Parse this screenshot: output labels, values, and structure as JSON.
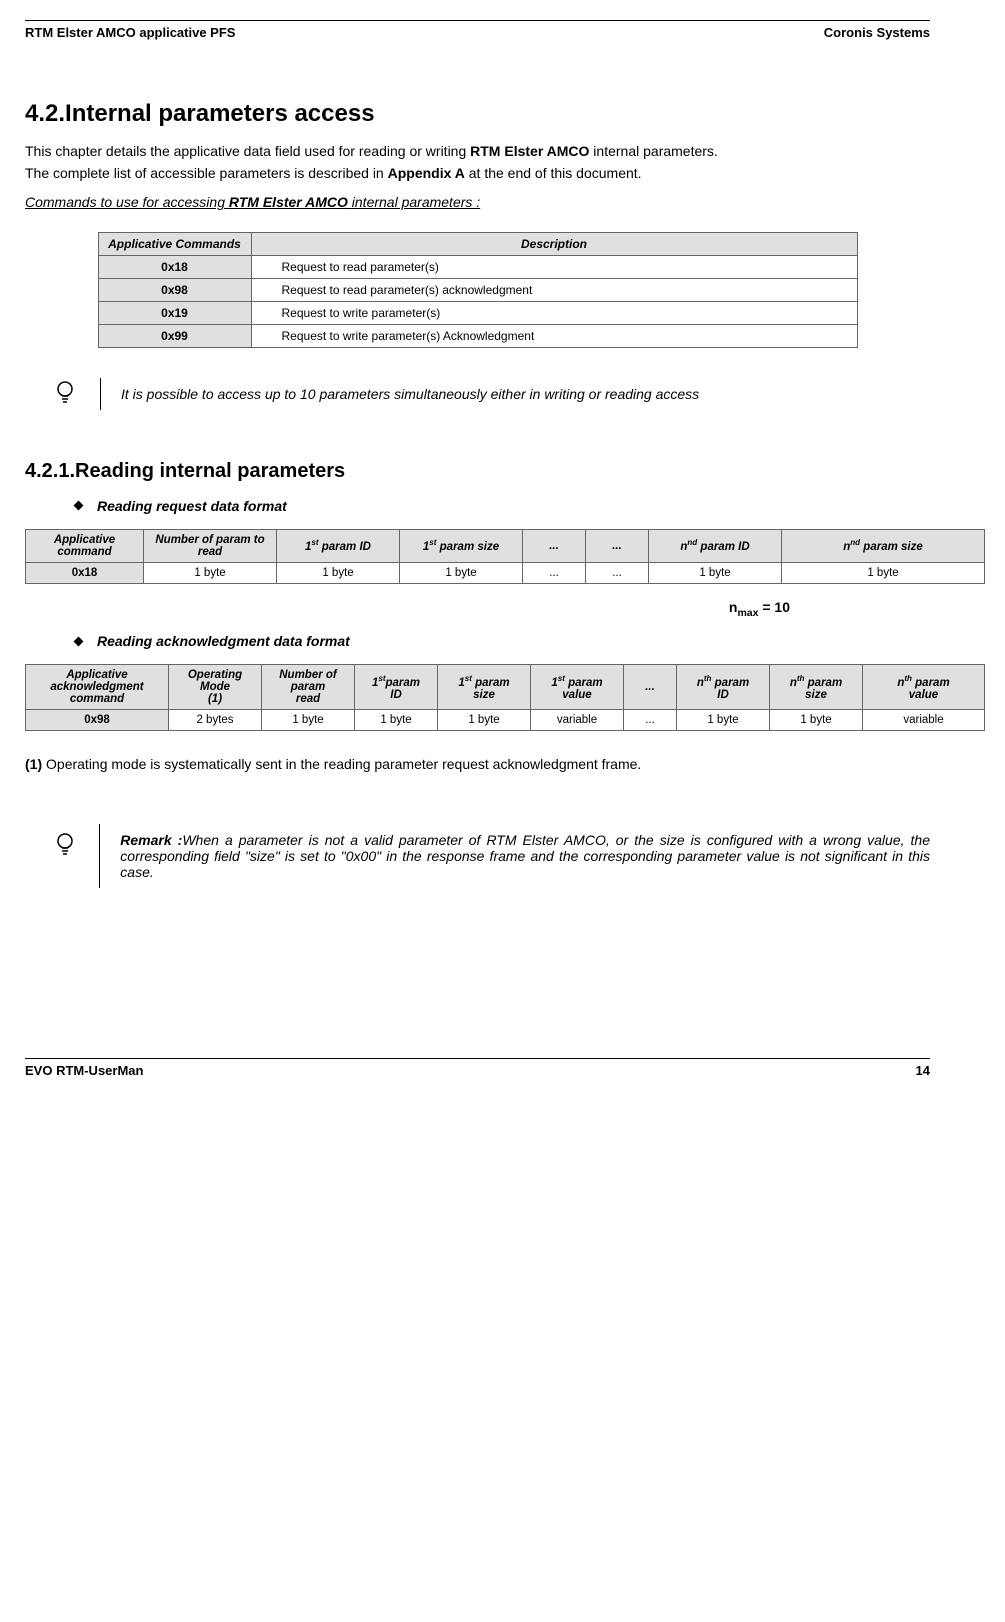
{
  "header": {
    "left": "RTM Elster AMCO applicative PFS",
    "right": "Coronis Systems"
  },
  "h1": "4.2.Internal parameters access",
  "intro1a": "This chapter details the applicative data field used for reading or writing ",
  "intro1b": "RTM Elster AMCO",
  "intro1c": " internal parameters.",
  "intro2a": "The complete list of accessible parameters is described in ",
  "intro2b": "Appendix A",
  "intro2c": " at the end of this document.",
  "cmds_title_a": "Commands to use for accessing ",
  "cmds_title_b": "RTM Elster AMCO",
  "cmds_title_c": " internal parameters :",
  "t1": {
    "h1": "Applicative Commands",
    "h2": "Description",
    "rows": [
      {
        "c": "0x18",
        "d": "Request to read parameter(s)"
      },
      {
        "c": "0x98",
        "d": "Request to read parameter(s) acknowledgment"
      },
      {
        "c": "0x19",
        "d": "Request to write parameter(s)"
      },
      {
        "c": "0x99",
        "d": "Request to write parameter(s) Acknowledgment"
      }
    ]
  },
  "note1": "It is possible to access up to 10 parameters simultaneously either in writing or reading access",
  "h2": "4.2.1.Reading internal parameters",
  "bullet1": "Reading request data format",
  "t2": {
    "h": [
      "Applicative command",
      "Number of param to read",
      "1st param ID",
      "1st param size",
      "...",
      "...",
      "nnd param ID",
      "nnd param size"
    ],
    "r": [
      "0x18",
      "1 byte",
      "1 byte",
      "1 byte",
      "...",
      "...",
      "1 byte",
      "1 byte"
    ]
  },
  "nmax": "nmax = 10",
  "bullet2": "Reading acknowledgment data format",
  "t3": {
    "h": [
      "Applicative acknowledgment command",
      "Operating Mode (1)",
      "Number of param read",
      "1stparam ID",
      "1st param size",
      "1st param value",
      "...",
      "nth param ID",
      "nth param size",
      "nth param value"
    ],
    "r": [
      "0x98",
      "2 bytes",
      "1 byte",
      "1 byte",
      "1 byte",
      "variable",
      "...",
      "1 byte",
      "1 byte",
      "variable"
    ]
  },
  "opmode_a": "(1)",
  "opmode_b": " Operating mode is systematically sent in the reading parameter request acknowledgment frame.",
  "remark_a": "Remark :",
  "remark_b": "When a parameter is not a valid parameter of RTM Elster AMCO, or the size is configured with a wrong value, the corresponding field \"size\" is set to \"0x00\" in the response frame and the corresponding parameter value is not significant in this case.",
  "footer": {
    "left": "EVO RTM-UserMan",
    "right": "14"
  }
}
